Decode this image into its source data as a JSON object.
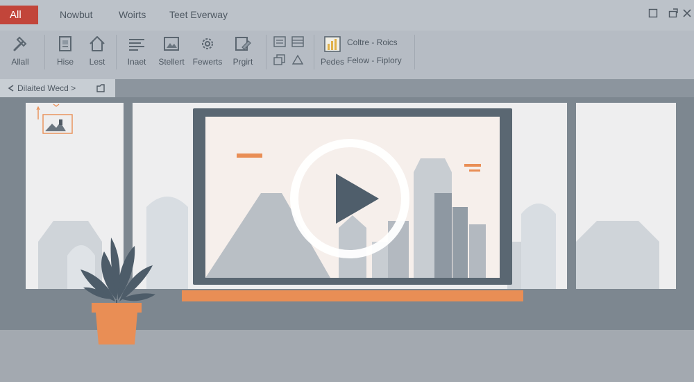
{
  "tabs": {
    "active": "All",
    "items": [
      "Nowbut",
      "Woirts",
      "Teet Everway"
    ]
  },
  "window": {
    "restore_glyph": "☐",
    "extra_glyph": "⍰",
    "close_glyph": "✕"
  },
  "ribbon": {
    "buttons": [
      {
        "label": "Allall",
        "icon": "hammer-icon"
      },
      {
        "label": "Hise",
        "icon": "document-icon"
      },
      {
        "label": "Lest",
        "icon": "home-icon"
      },
      {
        "label": "Inaet",
        "icon": "lines-icon"
      },
      {
        "label": "Stellert",
        "icon": "image-icon"
      },
      {
        "label": "Fewerts",
        "icon": "gear-icon"
      },
      {
        "label": "Prgirt",
        "icon": "edit-icon"
      },
      {
        "label": "Pedes",
        "icon": "chart-icon"
      }
    ],
    "text_row1": "Coltre - Roics",
    "text_row2": "Felow - Fiplory"
  },
  "breadcrumb": {
    "text": "Dilaited Wecd >",
    "back_glyph": "↶"
  },
  "colors": {
    "accent_orange": "#e98e55",
    "tab_red": "#c2453a",
    "frame": "#5a6772"
  }
}
